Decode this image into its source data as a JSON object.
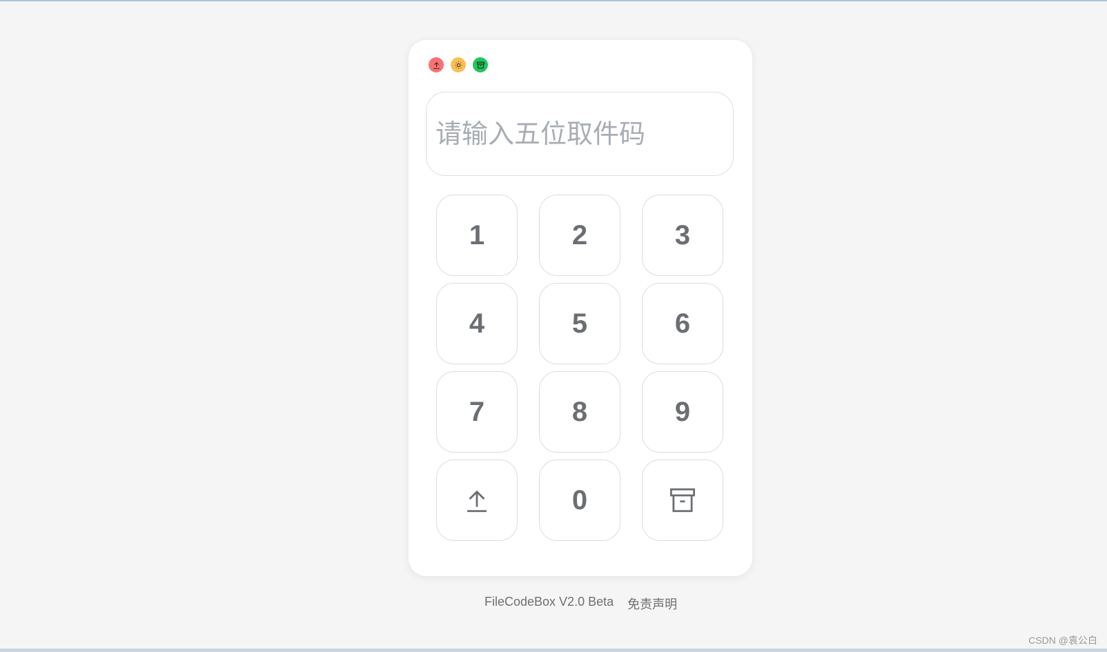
{
  "colors": {
    "page_bg": "#f5f5f5",
    "card_bg": "#ffffff",
    "dot_upload": "#f87171",
    "dot_theme": "#fbbf57",
    "dot_box": "#22c55e",
    "key_text": "#6b6e73"
  },
  "toolbar": {
    "dots": [
      {
        "name": "upload-dot",
        "icon": "upload-icon"
      },
      {
        "name": "theme-dot",
        "icon": "sun-icon"
      },
      {
        "name": "box-dot",
        "icon": "archive-icon"
      }
    ]
  },
  "code_input": {
    "placeholder": "请输入五位取件码",
    "value": ""
  },
  "keypad": {
    "keys": [
      {
        "label": "1"
      },
      {
        "label": "2"
      },
      {
        "label": "3"
      },
      {
        "label": "4"
      },
      {
        "label": "5"
      },
      {
        "label": "6"
      },
      {
        "label": "7"
      },
      {
        "label": "8"
      },
      {
        "label": "9"
      },
      {
        "label": "",
        "icon": "upload-icon"
      },
      {
        "label": "0"
      },
      {
        "label": "",
        "icon": "archive-icon"
      }
    ]
  },
  "footer": {
    "app_version": "FileCodeBox V2.0 Beta",
    "disclaimer": "免责声明"
  },
  "watermark": "CSDN @袁公白"
}
